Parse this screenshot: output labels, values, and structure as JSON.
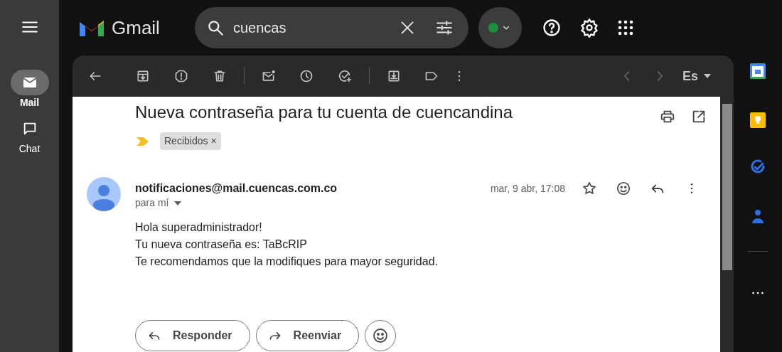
{
  "app": {
    "name": "Gmail"
  },
  "search": {
    "value": "cuencas"
  },
  "rail": [
    {
      "label": "Mail",
      "kind": "mail",
      "selected": true
    },
    {
      "label": "Chat",
      "kind": "chat",
      "selected": false
    }
  ],
  "toolbar": {
    "language": "Es"
  },
  "message": {
    "subject": "Nueva contraseña para tu cuenta de cuencandina",
    "label": "Recibidos",
    "label_remove": "×",
    "sender": "notificaciones@mail.cuencas.com.co",
    "recipient": "para mí",
    "date": "mar, 9 abr, 17:08",
    "starred": false,
    "body": [
      "Hola superadministrador!",
      "Tu nueva contraseña es: TaBcRIP",
      "Te recomendamos que la modifiques para mayor seguridad."
    ]
  },
  "actions": [
    {
      "kind": "reply",
      "label": "Responder"
    },
    {
      "kind": "forward",
      "label": "Reenviar"
    }
  ]
}
